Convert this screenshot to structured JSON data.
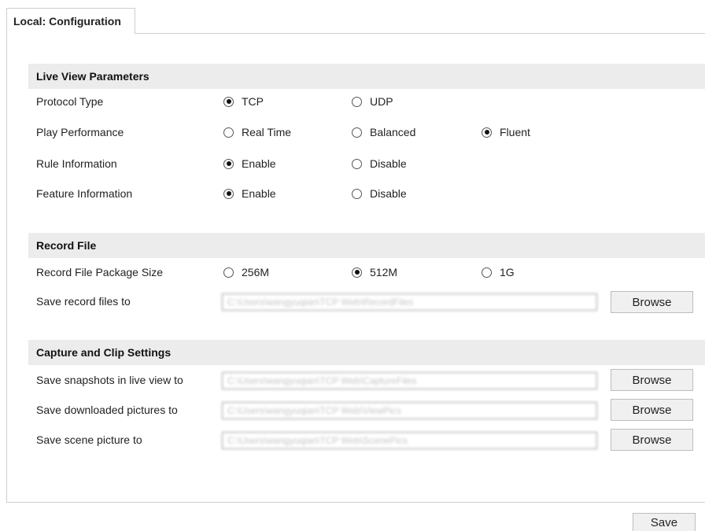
{
  "tab": {
    "title": "Local: Configuration"
  },
  "live_view": {
    "title": "Live View Parameters",
    "protocol": {
      "label": "Protocol Type",
      "options": [
        "TCP",
        "UDP"
      ],
      "selected": "TCP"
    },
    "play": {
      "label": "Play Performance",
      "options": [
        "Real Time",
        "Balanced",
        "Fluent"
      ],
      "selected": "Fluent"
    },
    "rule": {
      "label": "Rule Information",
      "options": [
        "Enable",
        "Disable"
      ],
      "selected": "Enable"
    },
    "feature": {
      "label": "Feature Information",
      "options": [
        "Enable",
        "Disable"
      ],
      "selected": "Enable"
    }
  },
  "record": {
    "title": "Record File",
    "package": {
      "label": "Record File Package Size",
      "options": [
        "256M",
        "512M",
        "1G"
      ],
      "selected": "512M"
    },
    "save_to": {
      "label": "Save record files to",
      "path": "C:\\Users\\wangyuqian\\TCP Web\\RecordFiles",
      "button": "Browse"
    }
  },
  "capture": {
    "title": "Capture and Clip Settings",
    "snapshots": {
      "label": "Save snapshots in live view to",
      "path": "C:\\Users\\wangyuqian\\TCP Web\\CaptureFiles",
      "button": "Browse"
    },
    "downloaded": {
      "label": "Save downloaded pictures to",
      "path": "C:\\Users\\wangyuqian\\TCP Web\\ViewPics",
      "button": "Browse"
    },
    "scene": {
      "label": "Save scene picture to",
      "path": "C:\\Users\\wangyuqian\\TCP Web\\ScenePics",
      "button": "Browse"
    }
  },
  "footer": {
    "save_label": "Save"
  }
}
